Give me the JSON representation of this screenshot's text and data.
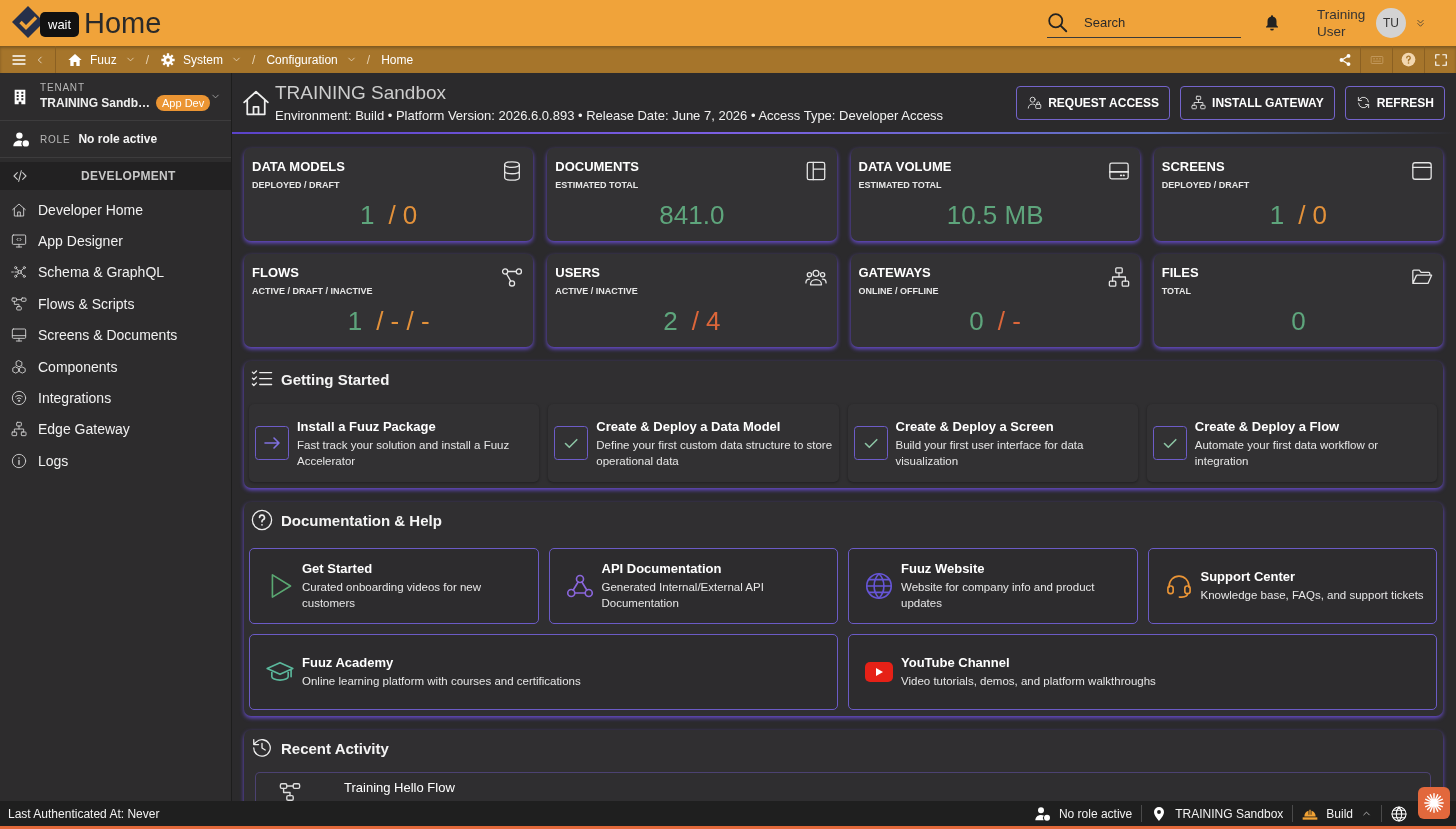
{
  "top_bar": {
    "tooltip": "wait",
    "title": "Home",
    "search": {
      "placeholder": "Search"
    },
    "user": {
      "name": "Training User",
      "initials": "TU"
    }
  },
  "breadcrumb": {
    "items": [
      {
        "label": "Fuuz",
        "dropdown": true
      },
      {
        "label": "System",
        "dropdown": true
      },
      {
        "label": "Configuration",
        "dropdown": true
      },
      {
        "label": "Home",
        "dropdown": false
      }
    ],
    "separators": [
      "/",
      "/",
      "/"
    ]
  },
  "sidebar": {
    "tenant": {
      "label": "TENANT",
      "name": "TRAINING Sandb…",
      "badge": "App Dev"
    },
    "role": {
      "label": "ROLE",
      "value": "No role active"
    },
    "section": "DEVELOPMENT",
    "items": [
      {
        "label": "Developer Home"
      },
      {
        "label": "App Designer"
      },
      {
        "label": "Schema & GraphQL"
      },
      {
        "label": "Flows & Scripts"
      },
      {
        "label": "Screens & Documents"
      },
      {
        "label": "Components"
      },
      {
        "label": "Integrations"
      },
      {
        "label": "Edge Gateway"
      },
      {
        "label": "Logs"
      }
    ]
  },
  "header": {
    "title": "TRAINING Sandbox",
    "subtitle": "Environment: Build • Platform Version: 2026.6.0.893 • Release Date: June 7, 2026 • Access Type: Developer Access",
    "buttons": [
      "REQUEST ACCESS",
      "INSTALL GATEWAY",
      "REFRESH"
    ]
  },
  "stats": [
    {
      "title": "DATA MODELS",
      "subtitle": "DEPLOYED / DRAFT",
      "values": [
        {
          "text": "1",
          "color": "#5ea57c"
        },
        {
          "text": "/ 0",
          "color": "#e3913a"
        }
      ]
    },
    {
      "title": "DOCUMENTS",
      "subtitle": "ESTIMATED TOTAL",
      "values": [
        {
          "text": "841.0",
          "color": "#5ea57c"
        }
      ]
    },
    {
      "title": "DATA VOLUME",
      "subtitle": "ESTIMATED TOTAL",
      "values": [
        {
          "text": "10.5 MB",
          "color": "#5ea57c"
        }
      ]
    },
    {
      "title": "SCREENS",
      "subtitle": "DEPLOYED / DRAFT",
      "values": [
        {
          "text": "1",
          "color": "#5ea57c"
        },
        {
          "text": "/ 0",
          "color": "#e3913a"
        }
      ]
    },
    {
      "title": "FLOWS",
      "subtitle": "ACTIVE / DRAFT / INACTIVE",
      "values": [
        {
          "text": "1",
          "color": "#5ea57c"
        },
        {
          "text": "/ - / -",
          "color": "#e3913a"
        }
      ]
    },
    {
      "title": "USERS",
      "subtitle": "ACTIVE / INACTIVE",
      "values": [
        {
          "text": "2",
          "color": "#5ea57c"
        },
        {
          "text": "/ 4",
          "color": "#dc663a"
        }
      ]
    },
    {
      "title": "GATEWAYS",
      "subtitle": "ONLINE / OFFLINE",
      "values": [
        {
          "text": "0",
          "color": "#5ea57c"
        },
        {
          "text": "/ -",
          "color": "#dc663a"
        }
      ]
    },
    {
      "title": "FILES",
      "subtitle": "TOTAL",
      "values": [
        {
          "text": "0",
          "color": "#5ea57c"
        }
      ]
    }
  ],
  "getting_started": {
    "title": "Getting Started",
    "items": [
      {
        "title": "Install a Fuuz Package",
        "description": "Fast track your solution and install a Fuuz Accelerator",
        "done": false
      },
      {
        "title": "Create & Deploy a Data Model",
        "description": "Define your first custom data structure to store operational data",
        "done": true
      },
      {
        "title": "Create & Deploy a Screen",
        "description": "Build your first user interface for data visualization",
        "done": true
      },
      {
        "title": "Create & Deploy a Flow",
        "description": "Automate your first data workflow or integration",
        "done": true
      }
    ]
  },
  "documentation": {
    "title": "Documentation & Help",
    "rows": [
      {
        "items": [
          {
            "title": "Get Started",
            "description": "Curated onboarding videos for new customers"
          },
          {
            "title": "API Documentation",
            "description": "Generated Internal/External API Documentation"
          },
          {
            "title": "Fuuz Website",
            "description": "Website for company info and product updates"
          },
          {
            "title": "Support Center",
            "description": "Knowledge base, FAQs, and support tickets"
          }
        ]
      },
      {
        "items": [
          {
            "title": "Fuuz Academy",
            "description": "Online learning platform with courses and certifications"
          },
          {
            "title": "YouTube Channel",
            "description": "Video tutorials, demos, and platform walkthroughs"
          }
        ]
      }
    ]
  },
  "recent_activity": {
    "title": "Recent Activity",
    "items": [
      {
        "title": "Training Hello Flow"
      }
    ]
  },
  "status_bar": {
    "last_auth": "Last Authenticated At: Never",
    "role": "No role active",
    "tenant": "TRAINING Sandbox",
    "environment": "Build"
  }
}
